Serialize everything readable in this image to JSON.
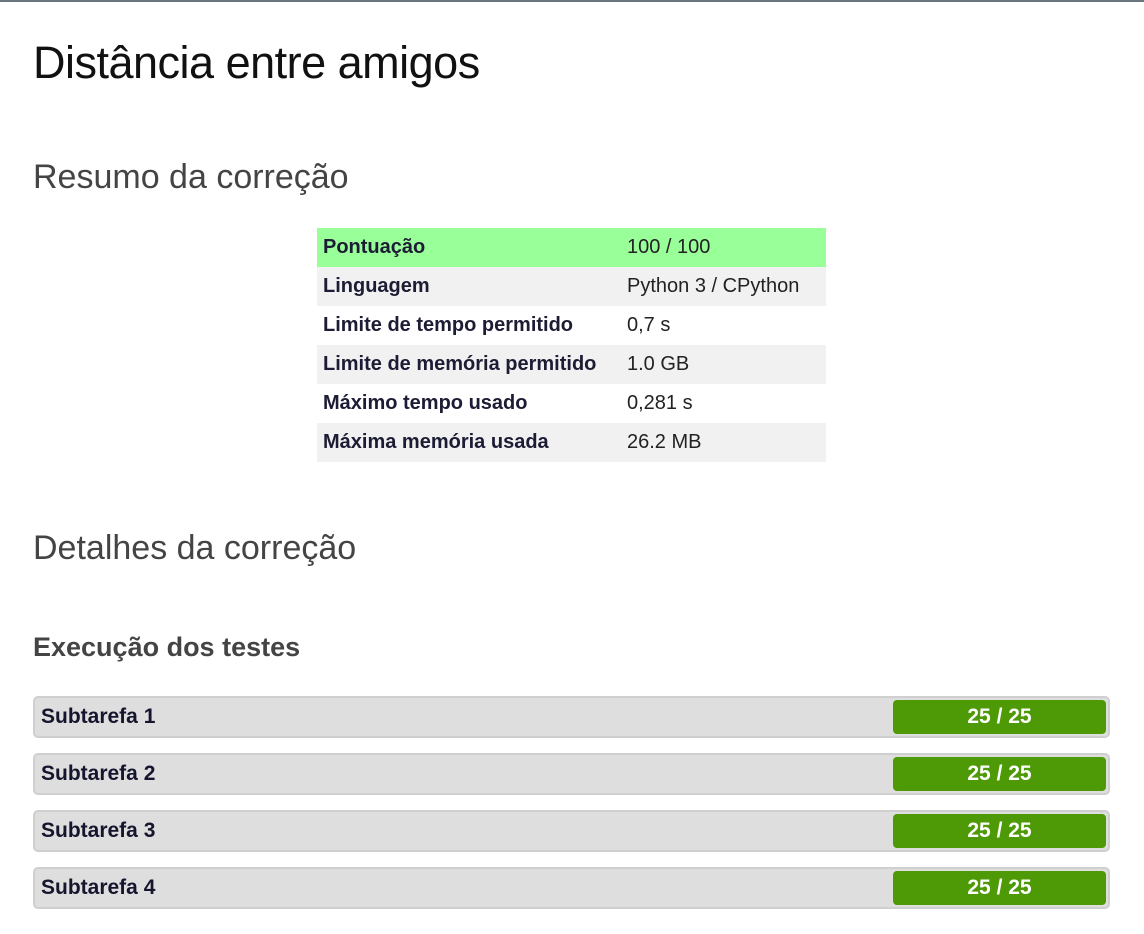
{
  "title": "Distância entre amigos",
  "summary": {
    "heading": "Resumo da correção",
    "rows": [
      {
        "label": "Pontuação",
        "value": "100 / 100"
      },
      {
        "label": "Linguagem",
        "value": "Python 3 / CPython"
      },
      {
        "label": "Limite de tempo permitido",
        "value": "0,7 s"
      },
      {
        "label": "Limite de memória permitido",
        "value": "1.0 GB"
      },
      {
        "label": "Máximo tempo usado",
        "value": "0,281 s"
      },
      {
        "label": "Máxima memória usada",
        "value": "26.2 MB"
      }
    ]
  },
  "details": {
    "heading": "Detalhes da correção",
    "tests_heading": "Execução dos testes",
    "subtasks": [
      {
        "name": "Subtarefa 1",
        "score": "25 / 25"
      },
      {
        "name": "Subtarefa 2",
        "score": "25 / 25"
      },
      {
        "name": "Subtarefa 3",
        "score": "25 / 25"
      },
      {
        "name": "Subtarefa 4",
        "score": "25 / 25"
      }
    ]
  },
  "colors": {
    "score_highlight": "#99ff99",
    "subtask_score_bg": "#4e9a06",
    "subtask_bar_bg": "#dedede"
  }
}
